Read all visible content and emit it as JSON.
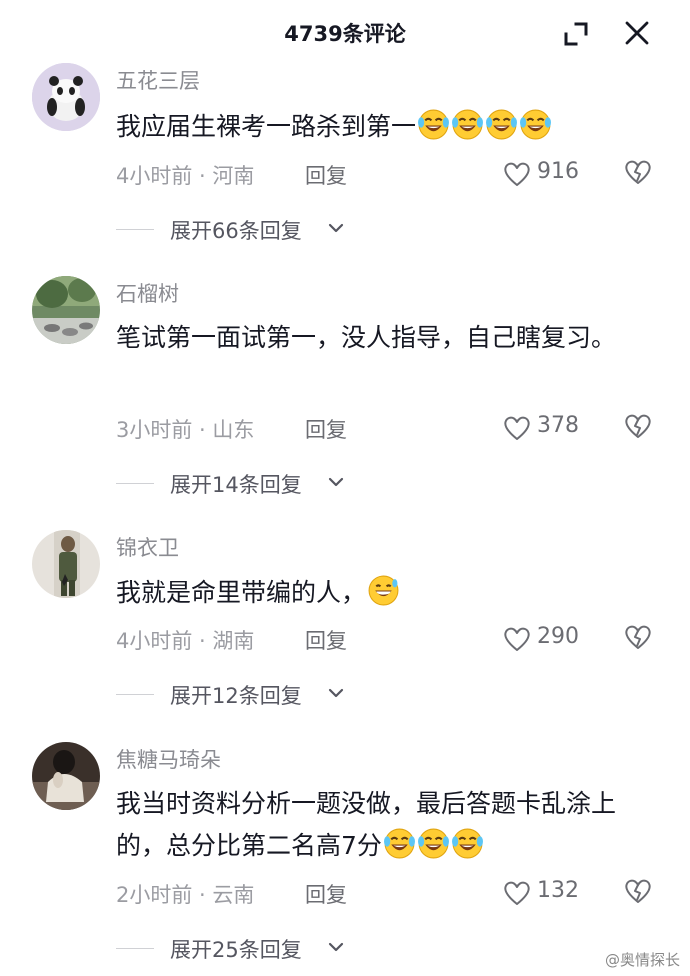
{
  "header": {
    "title": "4739条评论",
    "collapse_icon": "collapse-icon",
    "close_icon": "close-icon"
  },
  "comments": [
    {
      "username": "五花三层",
      "text": "我应届生裸考一路杀到第一",
      "emoji": [
        "laugh-cry-emoji",
        "laugh-cry-emoji",
        "laugh-cry-emoji",
        "laugh-cry-emoji"
      ],
      "meta": "4小时前 · 河南",
      "reply": "回复",
      "likes": "916",
      "expand": "展开66条回复"
    },
    {
      "username": "石榴树",
      "text": "笔试第一面试第一，没人指导，自己瞎复习。",
      "meta": "3小时前 · 山东",
      "reply": "回复",
      "likes": "378",
      "expand": "展开14条回复"
    },
    {
      "username": "锦衣卫",
      "text": "我就是命里带编的人，",
      "emoji": [
        "grin-sweat-emoji"
      ],
      "meta": "4小时前 · 湖南",
      "reply": "回复",
      "likes": "290",
      "expand": "展开12条回复"
    },
    {
      "username": "焦糖马琦朵",
      "text": "我当时资料分析一题没做，最后答题卡乱涂上的，总分比第二名高7分",
      "emoji": [
        "laugh-cry-emoji",
        "laugh-cry-emoji",
        "laugh-cry-emoji"
      ],
      "meta": "2小时前 · 云南",
      "reply": "回复",
      "likes": "132",
      "expand": "展开25条回复"
    }
  ],
  "watermark": "@奥情探长"
}
